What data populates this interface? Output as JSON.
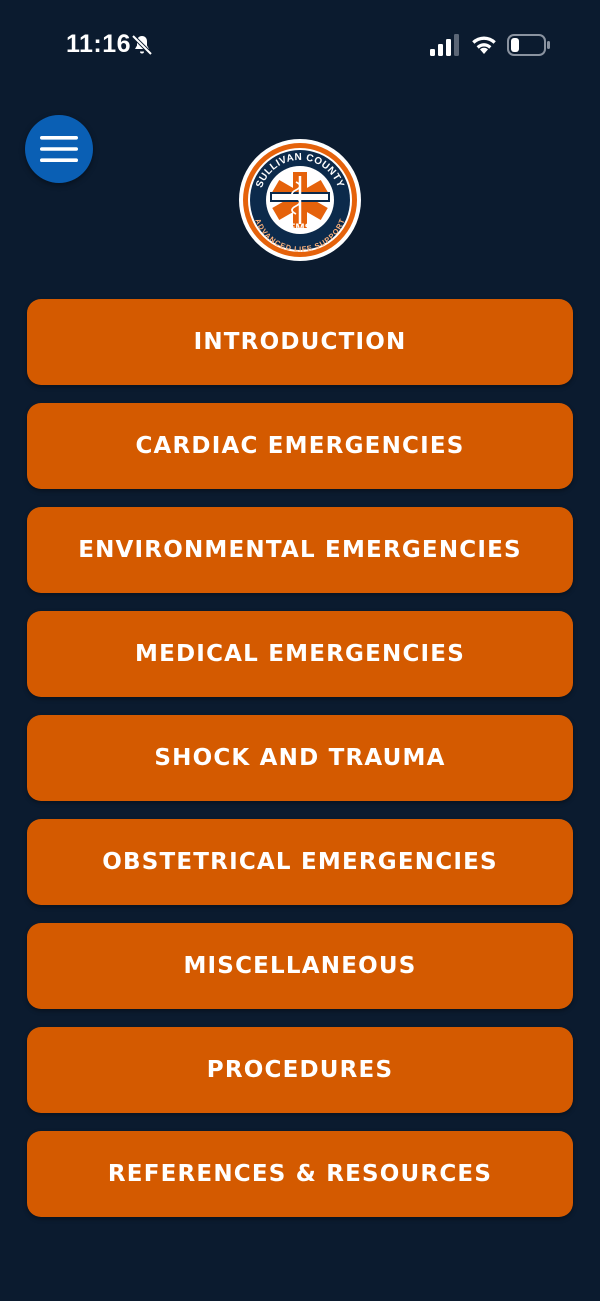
{
  "status_bar": {
    "time": "11:16",
    "icons": [
      "bell-slash-icon",
      "cellular-signal-icon",
      "wifi-icon",
      "battery-icon"
    ]
  },
  "header": {
    "menu_icon": "hamburger-menu-icon",
    "logo": {
      "top_text": "SULLIVAN COUNTY",
      "center_text": "EMS",
      "bottom_text": "ADVANCED LIFE SUPPORT"
    }
  },
  "colors": {
    "background": "#0b1b2f",
    "button": "#d45a00",
    "menu_button": "#0a5fb4"
  },
  "menu": {
    "items": [
      {
        "label": "INTRODUCTION"
      },
      {
        "label": "CARDIAC EMERGENCIES"
      },
      {
        "label": "ENVIRONMENTAL EMERGENCIES"
      },
      {
        "label": "MEDICAL EMERGENCIES"
      },
      {
        "label": "SHOCK AND TRAUMA"
      },
      {
        "label": "OBSTETRICAL EMERGENCIES"
      },
      {
        "label": "MISCELLANEOUS"
      },
      {
        "label": "PROCEDURES"
      },
      {
        "label": "REFERENCES & RESOURCES"
      }
    ]
  }
}
